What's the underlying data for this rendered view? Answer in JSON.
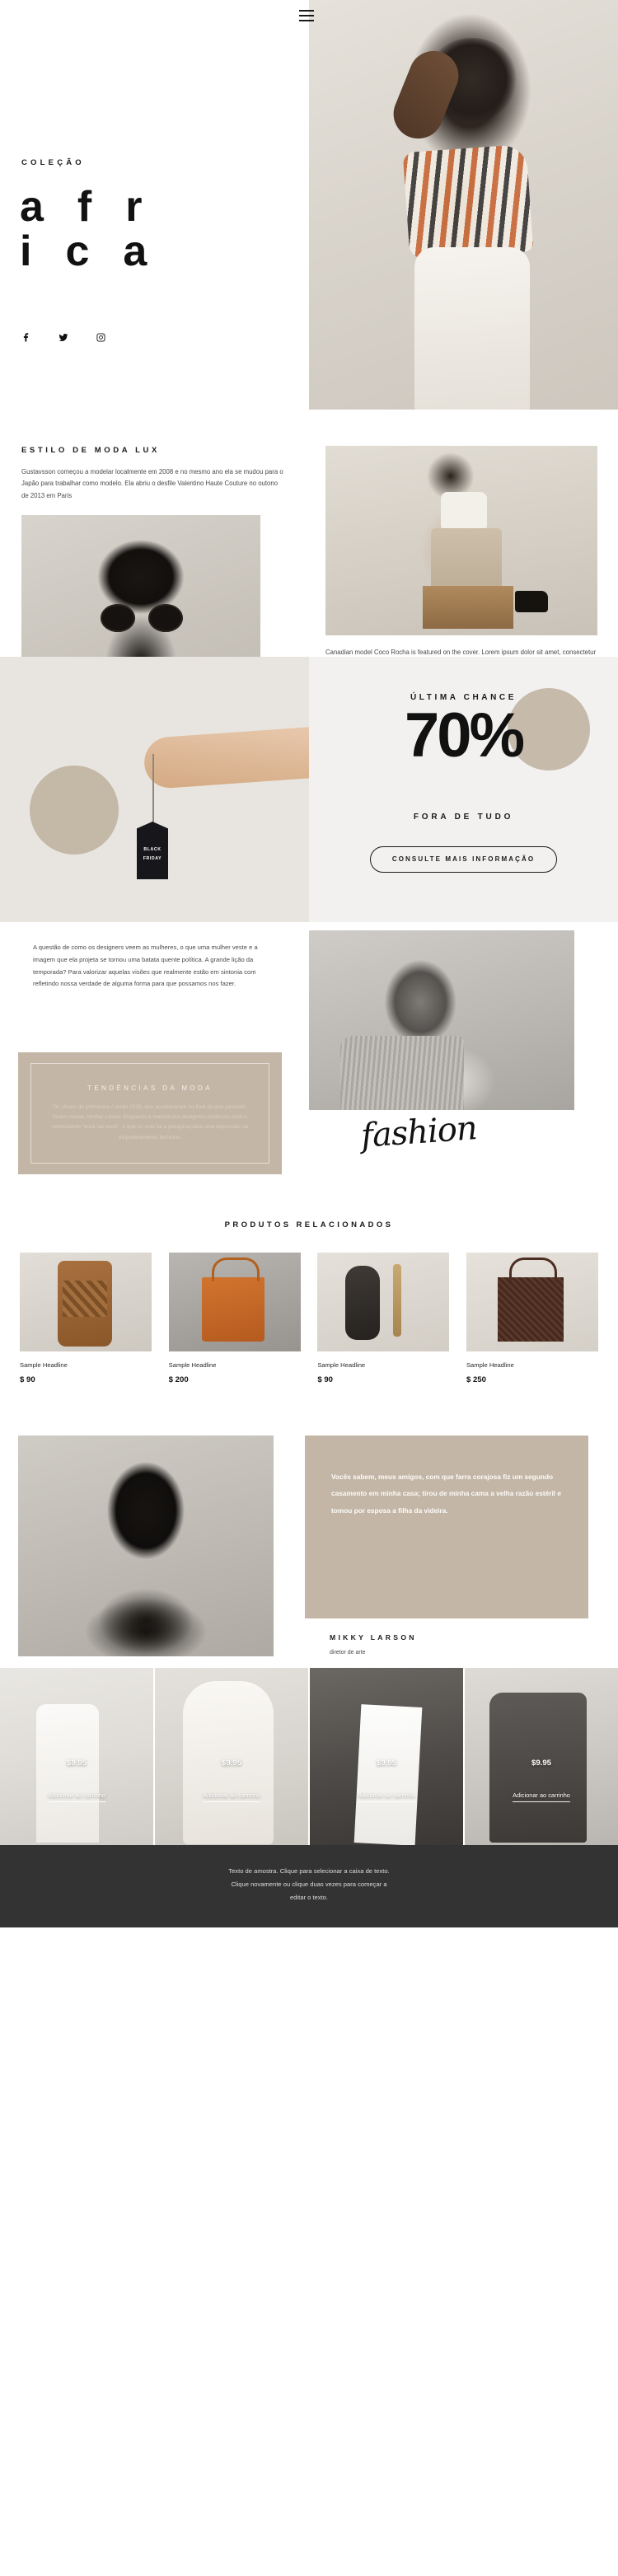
{
  "header": {
    "menu_icon": "hamburger-menu-icon"
  },
  "hero": {
    "kicker": "COLEÇÃO",
    "letters_row1": [
      "a",
      "f",
      "r"
    ],
    "letters_row2": [
      "i",
      "c",
      "a"
    ],
    "socials": [
      {
        "name": "facebook-icon",
        "label": "Facebook"
      },
      {
        "name": "twitter-icon",
        "label": "Twitter"
      },
      {
        "name": "instagram-icon",
        "label": "Instagram"
      }
    ]
  },
  "estilo": {
    "title": "ESTILO DE MODA LUX",
    "paragraph": "Gustavsson começou a modelar localmente em 2008 e no mesmo ano ela se mudou para o Japão para trabalhar como modelo. Ela abriu o desfile Valentino Haute Couture no outono de 2013 em Paris",
    "right_paragraph": "Canadian model Coco Rocha is featured on the cover. Lorem ipsum dolor sit amet, consectetur adipiscing elit nullam nunc justo sagittis suscipit ultrices. Maecenas convallis purus vel velit semper vehicula. Etiam consectetur aliquet lacus, nec efficitur diam consectetur nec.",
    "button": "CONSULTE MAIS INFORMAÇÃO"
  },
  "sale": {
    "tag_line1": "BLACK",
    "tag_line2": "FRIDAY",
    "kicker": "ÚLTIMA CHANCE",
    "big": "70%",
    "sub": "FORA DE TUDO",
    "button": "CONSULTE MAIS INFORMAÇÃO"
  },
  "trends": {
    "intro": "A questão de como os designers veem as mulheres, o que uma mulher veste e a imagem que ela projeta se tornou uma batata quente política. A grande lição da temporada? Para valorizar aquelas visões que realmente estão em sintonia com refletindo nossa verdade de alguma forma para que possamos nos fazer.",
    "card_title": "TENDÊNCIAS DA MODA",
    "card_text": "Os shows de primavera / verão 2019, que aconteceram no final do ano passado, foram muitas, muitas coisas. Enquanto a maioria dos designers continuou com o memorando \"você faz você\", o que os uniu foi a pesquisa para uma expressão de empoderamento feminino.",
    "script_word": "fashion"
  },
  "products": {
    "title": "PRODUTOS RELACIONADOS",
    "items": [
      {
        "name": "Sample Headline",
        "price": "$ 90",
        "image": "woven-sandal-image"
      },
      {
        "name": "Sample Headline",
        "price": "$ 200",
        "image": "tan-leather-tote-image"
      },
      {
        "name": "Sample Headline",
        "price": "$ 90",
        "image": "flip-flop-image"
      },
      {
        "name": "Sample Headline",
        "price": "$ 250",
        "image": "brown-woven-bag-image"
      }
    ]
  },
  "quote": {
    "text": "Vocês sabem, meus amigos, com que farra corajosa fiz um segundo casamento em minha casa; tirou de minha cama a velha razão estéril e tomou por esposa a filha da videira.",
    "name": "MIKKY LARSON",
    "role": "diretor de arte"
  },
  "gallery": {
    "items": [
      {
        "price": "$9.95",
        "cta": "Adicionar ao carrinho",
        "image": "white-outfit-image"
      },
      {
        "price": "$9.95",
        "cta": "Adicionar ao carrinho",
        "image": "cream-coat-image"
      },
      {
        "price": "$9.95",
        "cta": "Adicionar ao carrinho",
        "image": "white-dress-street-image"
      },
      {
        "price": "$9.95",
        "cta": "Adicionar ao carrinho",
        "image": "dark-jacket-image"
      }
    ]
  },
  "footer": {
    "line1": "Texto de amostra. Clique para selecionar a caixa de texto.",
    "line2": "Clique novamente ou clique duas vezes para começar a",
    "line3": "editar o texto."
  },
  "colors": {
    "accent_beige": "#c3b6a6",
    "sale_bg": "#f2f1ef",
    "footer_bg": "#333333",
    "ink": "#1a1a1a"
  }
}
